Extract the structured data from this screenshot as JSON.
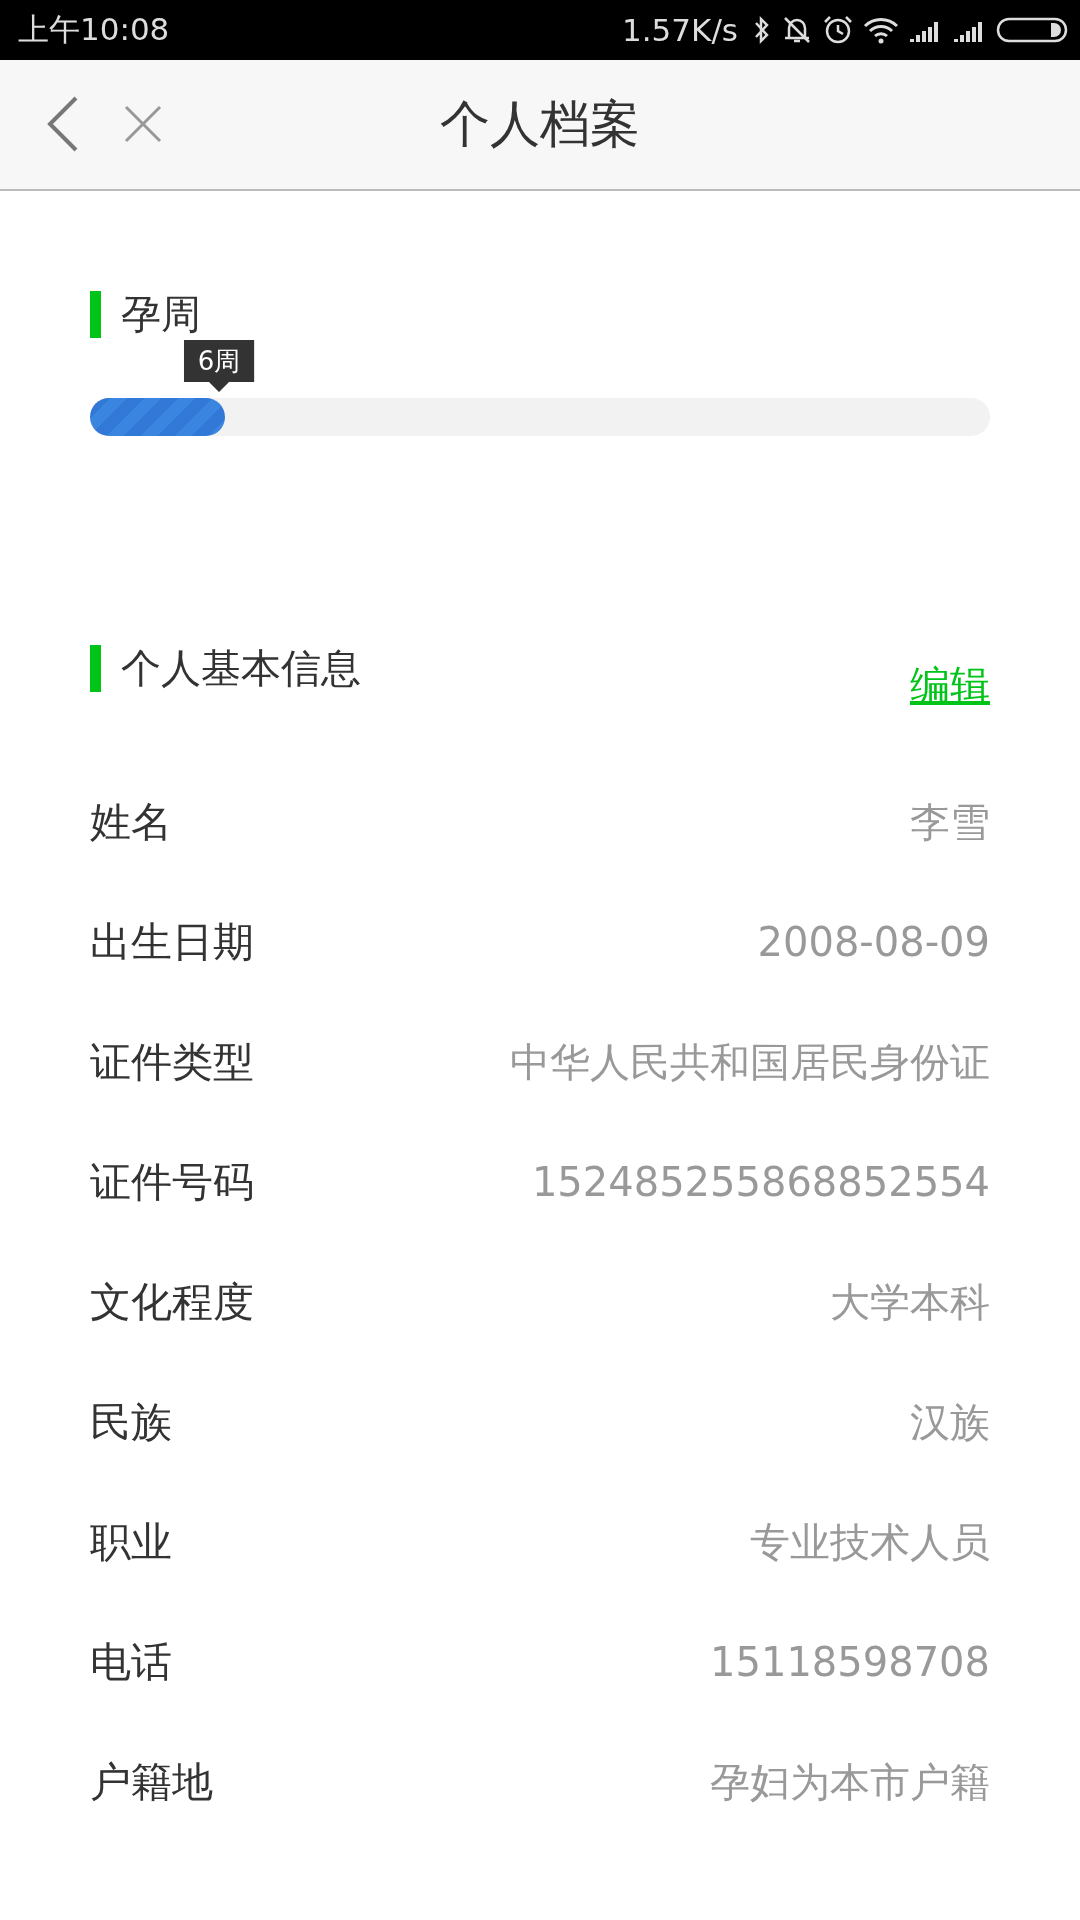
{
  "status_bar": {
    "time": "上午10:08",
    "speed": "1.57K/s"
  },
  "header": {
    "title": "个人档案"
  },
  "pregnancy": {
    "title": "孕周",
    "tooltip": "6周",
    "level": 0.15
  },
  "profile": {
    "title": "个人基本信息",
    "edit_link": "编辑",
    "rows": [
      {
        "label": "姓名",
        "value": "李雪"
      },
      {
        "label": "出生日期",
        "value": "2008-08-09"
      },
      {
        "label": "证件类型",
        "value": "中华人民共和国居民身份证"
      },
      {
        "label": "证件号码",
        "value": "152485255868852554"
      },
      {
        "label": "文化程度",
        "value": "大学本科"
      },
      {
        "label": "民族",
        "value": "汉族"
      },
      {
        "label": "职业",
        "value": "专业技术人员"
      },
      {
        "label": "电话",
        "value": "15118598708"
      },
      {
        "label": "户籍地",
        "value": "孕妇为本市户籍"
      }
    ]
  }
}
